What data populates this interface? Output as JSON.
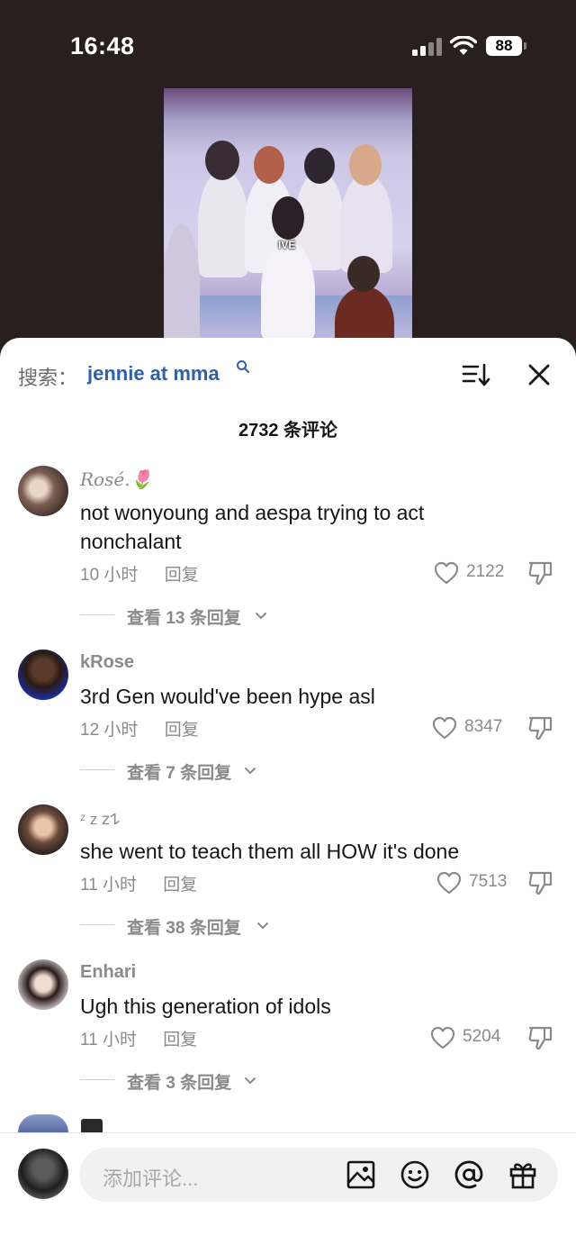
{
  "status": {
    "time": "16:48",
    "battery": "88"
  },
  "video": {
    "label": "IVE"
  },
  "search": {
    "prefix": "搜索：",
    "term": "jennie at mma"
  },
  "comments_count": "2732 条评论",
  "comments": [
    {
      "user": "Rosé.🌷",
      "text": "not wonyoung and aespa trying to act nonchalant",
      "time": "10 小时",
      "reply": "回复",
      "likes": "2122",
      "view_replies": "查看 13 条回复"
    },
    {
      "user": "kRose",
      "text": "3rd Gen would've been hype asl",
      "time": "12 小时",
      "reply": "回复",
      "likes": "8347",
      "view_replies": "查看 7 条回复"
    },
    {
      "user": "ᶻ z 𝗓𐰁",
      "text": "she went to teach them all HOW it's done",
      "time": "11 小时",
      "reply": "回复",
      "likes": "7513",
      "view_replies": "查看 38 条回复"
    },
    {
      "user": "Enhari",
      "text": "Ugh this generation of idols",
      "time": "11 小时",
      "reply": "回复",
      "likes": "5204",
      "view_replies": "查看 3 条回复"
    }
  ],
  "input": {
    "placeholder": "添加评论..."
  },
  "colors": {
    "accent": "#2f5fa8",
    "muted": "#8a8a8a",
    "text": "#161616",
    "video_bg": "#2a1f1f"
  }
}
